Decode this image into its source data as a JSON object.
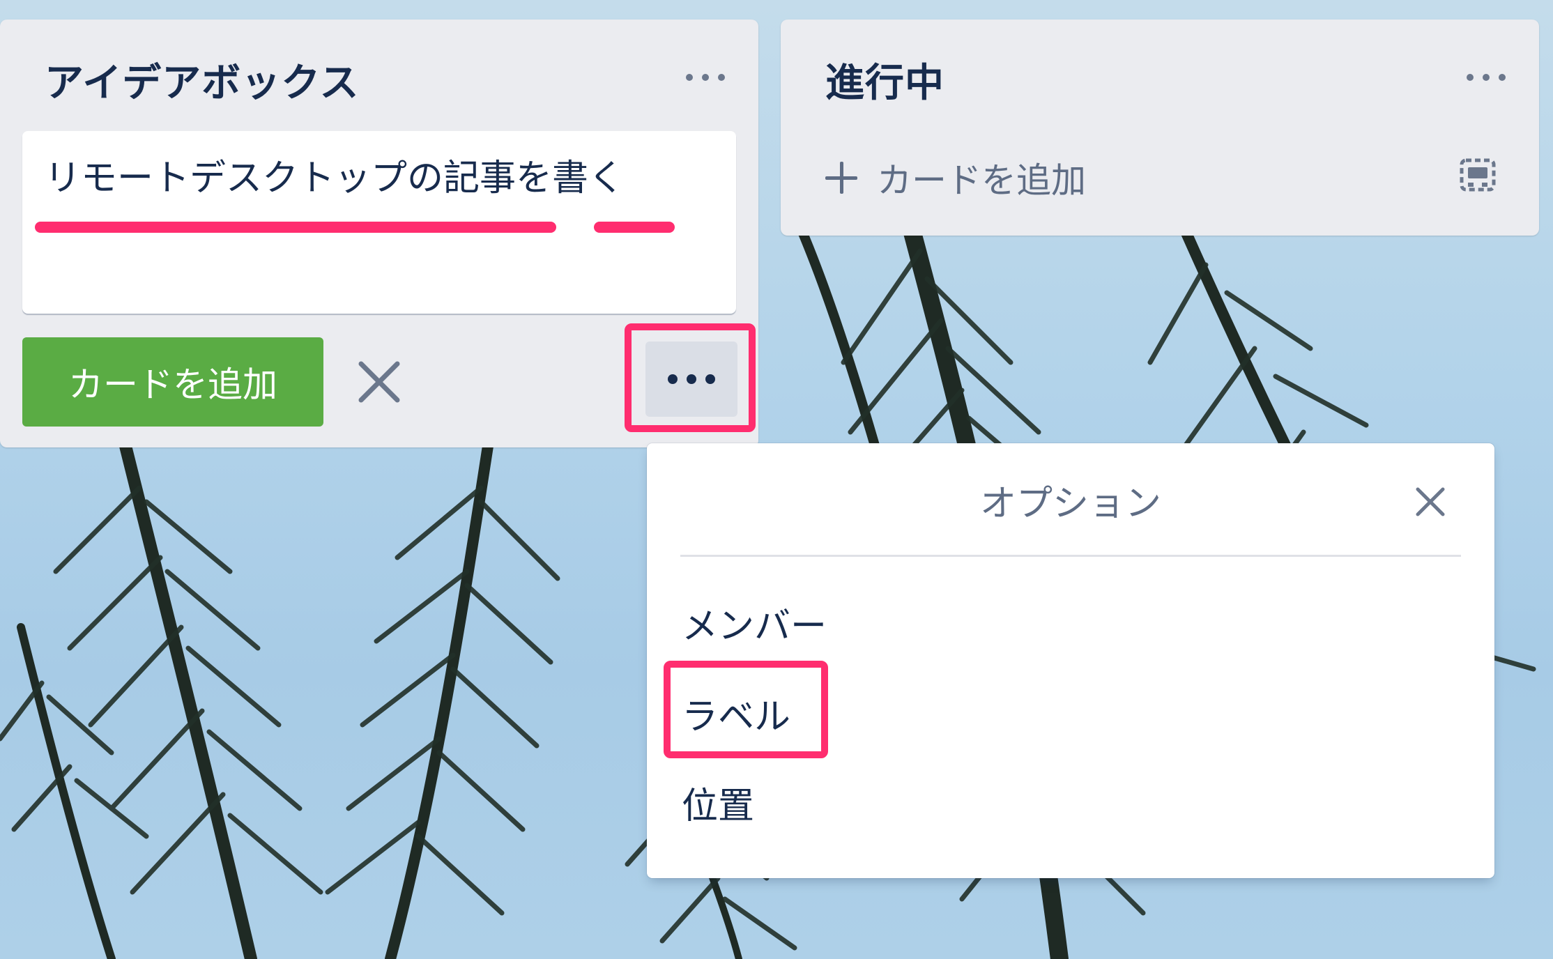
{
  "lists": [
    {
      "title": "アイデアボックス",
      "composer": {
        "text": "リモートデスクトップの記事を書く",
        "add_button": "カードを追加"
      }
    },
    {
      "title": "進行中",
      "add_card_label": "カードを追加"
    }
  ],
  "popover": {
    "title": "オプション",
    "items": [
      "メンバー",
      "ラベル",
      "位置"
    ]
  },
  "colors": {
    "highlight": "#ff2d6f",
    "add_button": "#5aac44",
    "list_bg": "#ebecf0"
  },
  "icons": [
    "more-icon",
    "close-icon",
    "plus-icon",
    "card-template-icon"
  ]
}
